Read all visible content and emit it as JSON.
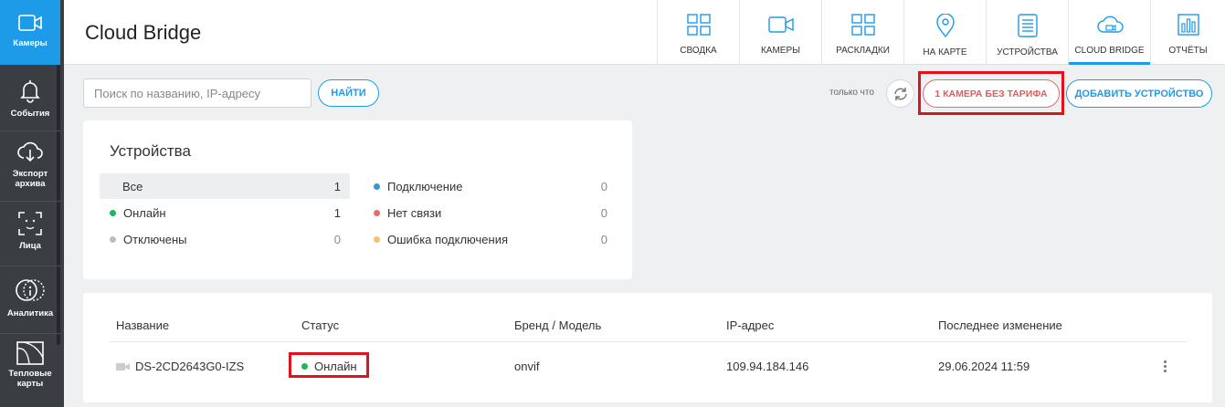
{
  "sidebar": {
    "items": [
      {
        "label": "Камеры",
        "icon": "camera-icon",
        "active": true
      },
      {
        "label": "События",
        "icon": "bell-icon"
      },
      {
        "label": "Экспорт архива",
        "icon": "cloud-download-icon"
      },
      {
        "label": "Лица",
        "icon": "face-scan-icon"
      },
      {
        "label": "Аналитика",
        "icon": "analytics-icon"
      },
      {
        "label": "Тепловые карты",
        "icon": "heatmap-icon"
      }
    ]
  },
  "header": {
    "title": "Cloud Bridge",
    "nav": [
      {
        "label": "СВОДКА",
        "icon": "grid-icon"
      },
      {
        "label": "КАМЕРЫ",
        "icon": "camera-icon"
      },
      {
        "label": "РАСКЛАДКИ",
        "icon": "layout-icon"
      },
      {
        "label": "НА КАРТЕ",
        "icon": "map-pin-icon"
      },
      {
        "label": "УСТРОЙСТВА",
        "icon": "device-list-icon"
      },
      {
        "label": "CLOUD BRIDGE",
        "icon": "cloud-camera-icon",
        "active": true
      },
      {
        "label": "ОТЧЁТЫ",
        "icon": "bar-chart-icon"
      }
    ]
  },
  "toolbar": {
    "search_placeholder": "Поиск по названию, IP-адресу",
    "search_value": "",
    "find_label": "НАЙТИ",
    "updated_text": "только что",
    "tariff_label": "1 КАМЕРА БЕЗ ТАРИФА",
    "add_label": "ДОБАВИТЬ УСТРОЙСТВО"
  },
  "devices": {
    "title": "Устройства",
    "left": [
      {
        "label": "Все",
        "count": "1",
        "dot": null
      },
      {
        "label": "Онлайн",
        "count": "1",
        "dot": "#22b35e"
      },
      {
        "label": "Отключены",
        "count": "0",
        "dot": "#bdbdbd"
      }
    ],
    "right": [
      {
        "label": "Подключение",
        "count": "0",
        "dot": "#2e9be0"
      },
      {
        "label": "Нет связи",
        "count": "0",
        "dot": "#e86a6a"
      },
      {
        "label": "Ошибка подключения",
        "count": "0",
        "dot": "#f5c26b"
      }
    ]
  },
  "table": {
    "columns": [
      "Название",
      "Статус",
      "Бренд / Модель",
      "IP-адрес",
      "Последнее изменение"
    ],
    "rows": [
      {
        "name": "DS-2CD2643G0-IZS",
        "status": "Онлайн",
        "status_color": "#22b35e",
        "brand": "onvif",
        "ip": "109.94.184.146",
        "changed": "29.06.2024 11:59"
      }
    ]
  },
  "colors": {
    "accent": "#1e9be8",
    "warning": "#e05b5b",
    "highlight": "#e0121c"
  }
}
